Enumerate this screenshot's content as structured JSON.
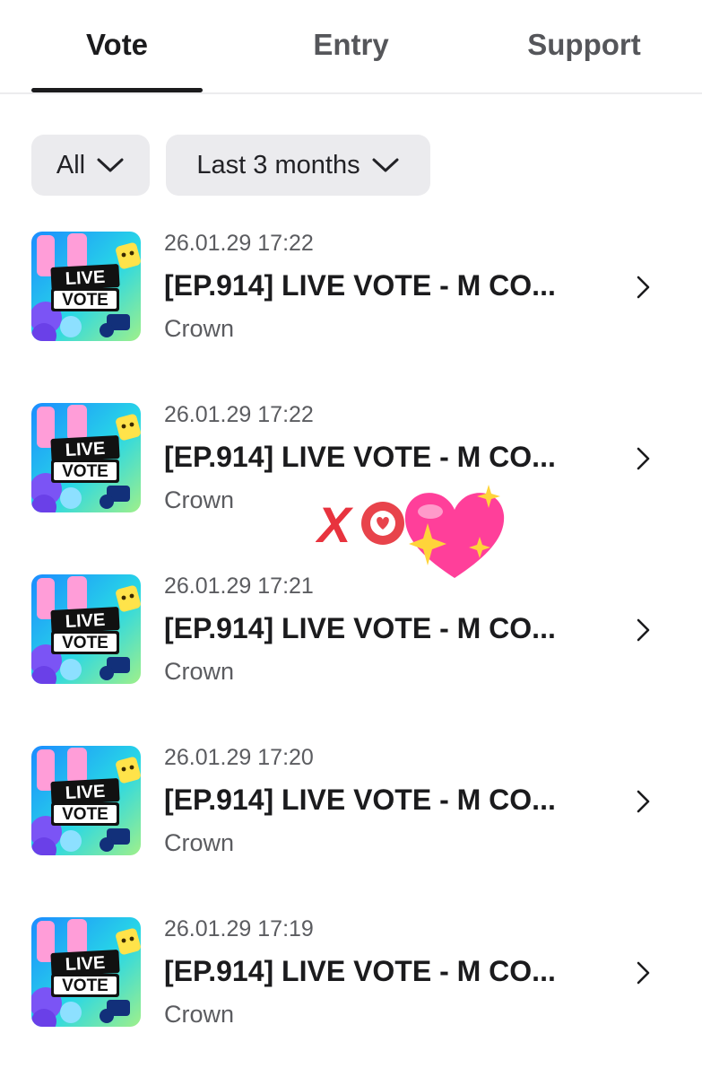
{
  "tabs": [
    {
      "label": "Vote",
      "active": true
    },
    {
      "label": "Entry",
      "active": false
    },
    {
      "label": "Support",
      "active": false
    }
  ],
  "filters": {
    "type": {
      "label": "All",
      "icon": "chevron-down-icon"
    },
    "period": {
      "label": "Last 3 months",
      "icon": "chevron-down-icon"
    }
  },
  "thumbnail_text": {
    "line1": "LIVE",
    "line2": "VOTE"
  },
  "items": [
    {
      "date": "26.01.29 17:22",
      "title": "[EP.914] LIVE VOTE - M CO...",
      "sub": "Crown"
    },
    {
      "date": "26.01.29 17:22",
      "title": "[EP.914] LIVE VOTE - M CO...",
      "sub": "Crown"
    },
    {
      "date": "26.01.29 17:21",
      "title": "[EP.914] LIVE VOTE - M CO...",
      "sub": "Crown"
    },
    {
      "date": "26.01.29 17:20",
      "title": "[EP.914] LIVE VOTE - M CO...",
      "sub": "Crown"
    },
    {
      "date": "26.01.29 17:19",
      "title": "[EP.914] LIVE VOTE - M CO...",
      "sub": "Crown"
    }
  ],
  "sticker": {
    "text": "X",
    "icons": [
      "heart-badge-icon",
      "sparkling-heart-icon"
    ]
  },
  "colors": {
    "text_primary": "#1b1b1d",
    "text_secondary": "#5b5c60",
    "filter_bg": "#ebebee",
    "sticker_red": "#e8333e",
    "heart_pink": "#ff3f9a"
  }
}
